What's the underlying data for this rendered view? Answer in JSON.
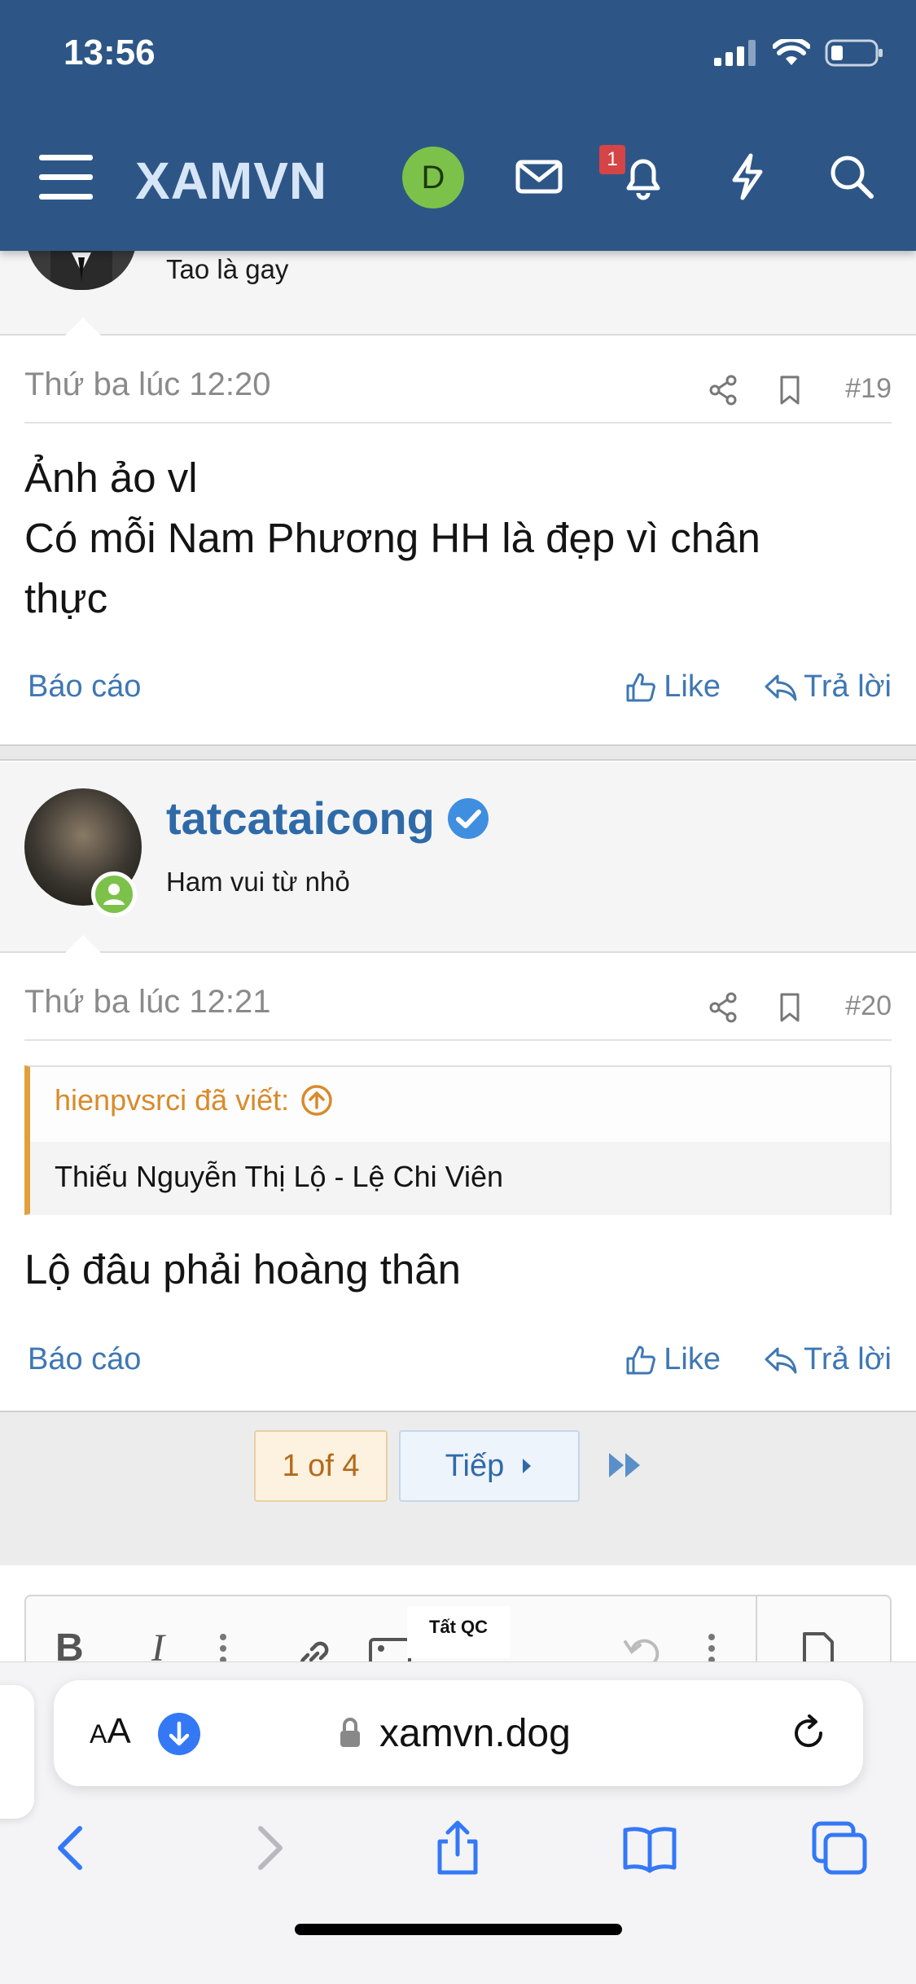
{
  "status": {
    "time": "13:56"
  },
  "nav": {
    "brand": "XAMVN",
    "user_initial": "D",
    "notification_count": "1"
  },
  "post19": {
    "prev_signature": "Tao là gay",
    "date": "Thứ ba lúc 12:20",
    "number": "#19",
    "lines": [
      "Ảnh ảo vl",
      "Có mỗi Nam Phương HH là đẹp vì chân",
      "thực"
    ],
    "report": "Báo cáo",
    "like": "Like",
    "reply": "Trả lời"
  },
  "post20": {
    "username": "tatcataicong",
    "signature": "Ham vui từ nhỏ",
    "date": "Thứ ba lúc 12:21",
    "number": "#20",
    "quote_author": "hienpvsrci đã viết:",
    "quote_text": "Thiếu Nguyễn Thị Lộ - Lệ Chi Viên",
    "content": "Lộ đâu phải hoàng thân",
    "report": "Báo cáo",
    "like": "Like",
    "reply": "Trả lời"
  },
  "pagination": {
    "current": "1 of 4",
    "next": "Tiếp"
  },
  "editor": {
    "bold": "B",
    "italic": "I",
    "ad_label": "Tất QC"
  },
  "browser": {
    "text_size": "AA",
    "domain": "xamvn.dog"
  }
}
